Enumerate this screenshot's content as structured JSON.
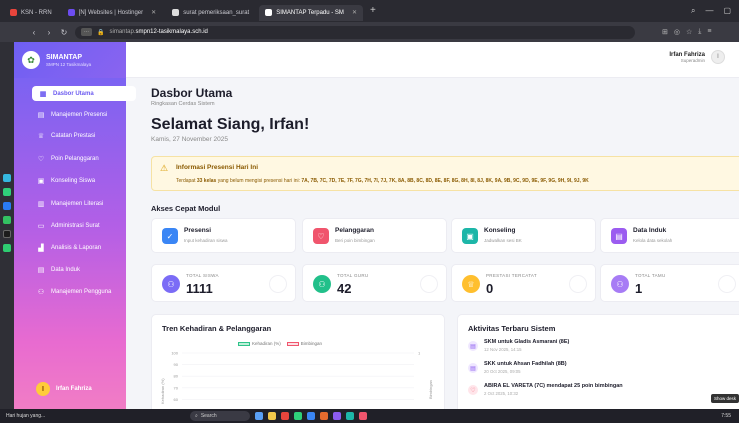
{
  "browser": {
    "tabs": [
      {
        "label": "KSN - RRN",
        "active": false
      },
      {
        "label": "[N] Websites | Hostinger",
        "active": false
      },
      {
        "label": "surat pemeriksaan_surat",
        "active": false
      },
      {
        "label": "SIMANTAP Terpadu - SM",
        "active": true
      }
    ],
    "url_prefix": "simantap.",
    "url_host": "smpn12-tasikmalaya.sch.id"
  },
  "app": {
    "brand_title": "SIMANTAP",
    "brand_sub": "SMPN 12 Tasikmalaya",
    "user_name": "Irfan Fahriza",
    "user_role": "Superadmin",
    "avatar_initial": "I"
  },
  "sidebar": {
    "items": [
      {
        "label": "Dasbor Utama",
        "icon": "dashboard-icon",
        "active": true
      },
      {
        "label": "Manajemen Presensi",
        "icon": "calendar-icon",
        "active": false
      },
      {
        "label": "Catatan Prestasi",
        "icon": "trophy-icon",
        "active": false
      },
      {
        "label": "Poin Pelanggaran",
        "icon": "shield-icon",
        "active": false
      },
      {
        "label": "Konseling Siswa",
        "icon": "chat-icon",
        "active": false
      },
      {
        "label": "Manajemen Literasi",
        "icon": "book-icon",
        "active": false
      },
      {
        "label": "Administrasi Surat",
        "icon": "document-icon",
        "active": false
      },
      {
        "label": "Analisis & Laporan",
        "icon": "chart-icon",
        "active": false
      },
      {
        "label": "Data Induk",
        "icon": "database-icon",
        "active": false
      },
      {
        "label": "Manajemen Pengguna",
        "icon": "users-icon",
        "active": false
      }
    ],
    "user_name": "Irfan Fahriza"
  },
  "main": {
    "title": "Dasbor Utama",
    "subtitle": "Ringkasan Cerdas Sistem",
    "greeting": "Selamat Siang, Irfan!",
    "date": "Kamis, 27 November 2025",
    "alert": {
      "title": "Informasi Presensi Hari Ini",
      "prefix": "Terdapat ",
      "count": "33 kelas",
      "suffix": " yang belum mengisi presensi hari ini: ",
      "classes": "7A, 7B, 7C, 7D, 7E, 7F, 7G, 7H, 7I, 7J, 7K, 8A, 8B, 8C, 8D, 8E, 8F, 8G, 8H, 8I, 8J, 8K, 9A, 9B, 9C, 9D, 9E, 9F, 9G, 9H, 9I, 9J, 9K"
    },
    "quick_title": "Akses Cepat Modul",
    "quick": [
      {
        "title": "Presensi",
        "sub": "Input kehadiran siswa",
        "color": "#3a86f5",
        "icon": "check-icon"
      },
      {
        "title": "Pelanggaran",
        "sub": "Beri poin bimbingan",
        "color": "#f0556d",
        "icon": "heart-icon"
      },
      {
        "title": "Konseling",
        "sub": "Jadwalkan sesi BK",
        "color": "#1db6a8",
        "icon": "clipboard-icon"
      },
      {
        "title": "Data Induk",
        "sub": "Kelola data sekolah",
        "color": "#9b5cf0",
        "icon": "database-icon"
      }
    ],
    "stats": [
      {
        "label": "TOTAL SISWA",
        "value": "1111",
        "color": "#7b6cf6"
      },
      {
        "label": "TOTAL GURU",
        "value": "42",
        "color": "#22c08a"
      },
      {
        "label": "PRESTASI TERCATAT",
        "value": "0",
        "color": "#ffbf2e"
      },
      {
        "label": "TOTAL TAMU",
        "value": "1",
        "color": "#a77cf5"
      }
    ],
    "chart_panel_title": "Tren Kehadiran & Pelanggaran",
    "activity_title": "Aktivitas Terbaru Sistem",
    "activities": [
      {
        "title": "SKM untuk Gladis Asmarani (8E)",
        "time": "12 Nov 2025, 14:15",
        "color": "#8c5cf0"
      },
      {
        "title": "SKK untuk Ahsan Fadhilah (8B)",
        "time": "20 Oct 2025, 09:05",
        "color": "#8c5cf0"
      },
      {
        "title": "ABIRA EL VARETA (7C) mendapat 25 poin bimbingan",
        "time": "2 Oct 2025, 10:32",
        "color": "#f0556d"
      }
    ],
    "tooltip": "Show desk"
  },
  "chart_data": {
    "type": "line",
    "title": "Tren Kehadiran & Pelanggaran",
    "series": [
      {
        "name": "Kehadiran (%)",
        "color": "#2fc38a",
        "values": []
      },
      {
        "name": "Bimbingan",
        "color": "#f0556d",
        "values": []
      }
    ],
    "yticks": [
      "100",
      "90",
      "80",
      "70",
      "60",
      "50"
    ],
    "ylabel": "Kehadiran (%)",
    "y2ticks": [
      "1"
    ],
    "y2label": "Bimbingan",
    "ylim": [
      50,
      100
    ]
  },
  "taskbar": {
    "weather": "Hari hujan yang...",
    "search": "Search",
    "right": "7:55"
  }
}
